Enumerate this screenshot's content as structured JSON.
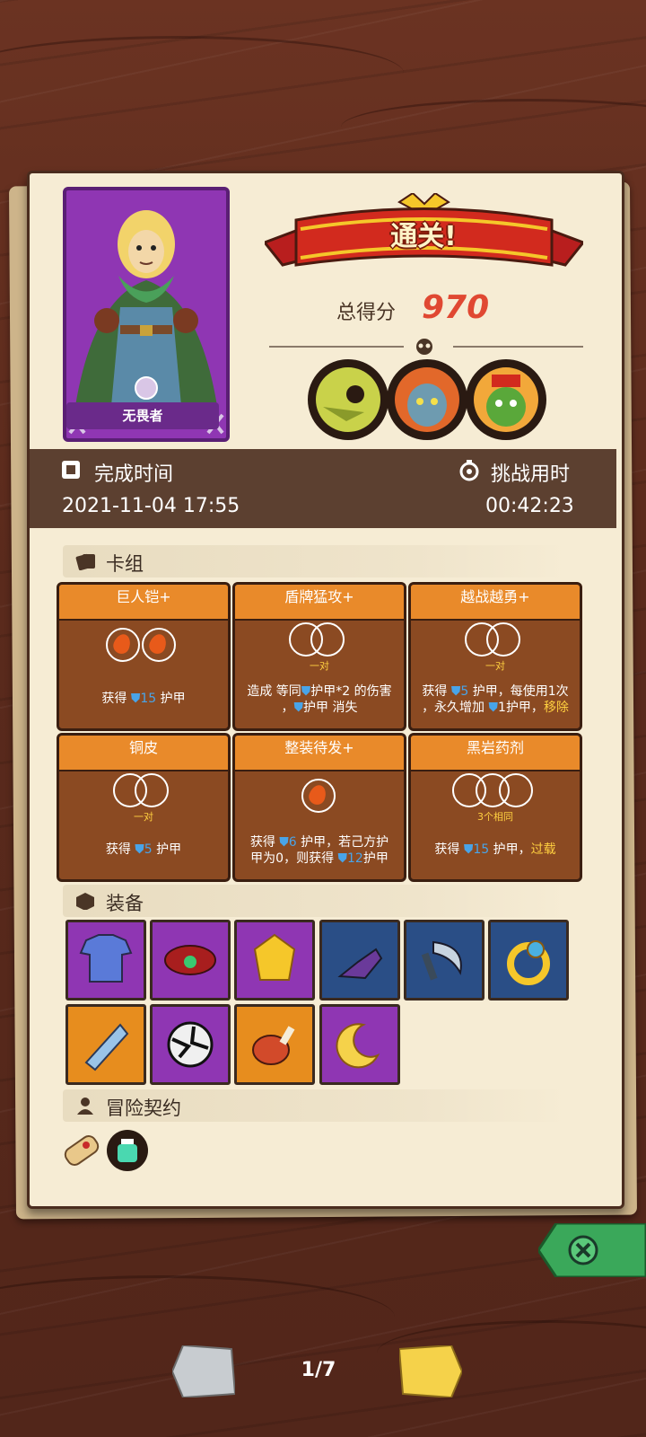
{
  "result": {
    "banner_text": "通关!",
    "score_label": "总得分",
    "score_value": "970",
    "hero_name": "无畏者"
  },
  "time": {
    "complete_label": "完成时间",
    "complete_value": "2021-11-04 17:55",
    "duration_label": "挑战用时",
    "duration_value": "00:42:23"
  },
  "deck": {
    "header": "卡组",
    "cards": [
      {
        "title": "巨人铠+",
        "sub": "",
        "desc_a": "获得 ",
        "shield": "15",
        "desc_b": " 护甲"
      },
      {
        "title": "盾牌猛攻+",
        "sub": "一对",
        "desc_a": "造成 等同",
        "shield": "",
        "desc_b": "护甲*2 的伤害",
        "desc_c": "，",
        "desc_d": "护甲 消失"
      },
      {
        "title": "越战越勇+",
        "sub": "一对",
        "desc_a": "获得 ",
        "shield": "5",
        "desc_b": " 护甲，每使用1次",
        "desc_c": "，永久增加 ",
        "shield2": "1",
        "desc_d": "护甲，",
        "hl": "移除"
      },
      {
        "title": "铜皮",
        "sub": "一对",
        "desc_a": "获得 ",
        "shield": "5",
        "desc_b": " 护甲"
      },
      {
        "title": "整装待发+",
        "sub": "",
        "desc_a": "获得 ",
        "shield": "6",
        "desc_b": " 护甲，若己方护",
        "desc_c": "甲为0，则获得 ",
        "shield2": "12",
        "desc_d": "护甲"
      },
      {
        "title": "黑岩药剂",
        "sub": "3个相同",
        "desc_a": "获得 ",
        "shield": "15",
        "desc_b": " 护甲，",
        "hl": "过载"
      }
    ]
  },
  "equipment": {
    "header": "装备",
    "items": [
      {
        "name": "tunic",
        "color": "#8f36b3"
      },
      {
        "name": "red-belt",
        "color": "#8f36b3"
      },
      {
        "name": "amber-gem",
        "color": "#8f36b3"
      },
      {
        "name": "gauntlet",
        "color": "#2a4e86"
      },
      {
        "name": "sickle",
        "color": "#2a4e86"
      },
      {
        "name": "gold-ring",
        "color": "#2a4e86"
      },
      {
        "name": "ice-shard",
        "color": "#e78d1e"
      },
      {
        "name": "cracked-orb",
        "color": "#8f36b3"
      },
      {
        "name": "meat-leg",
        "color": "#e78d1e"
      },
      {
        "name": "moon-charm",
        "color": "#8f36b3"
      }
    ]
  },
  "contract": {
    "header": "冒险契约"
  },
  "pager": {
    "indicator": "1/7"
  }
}
